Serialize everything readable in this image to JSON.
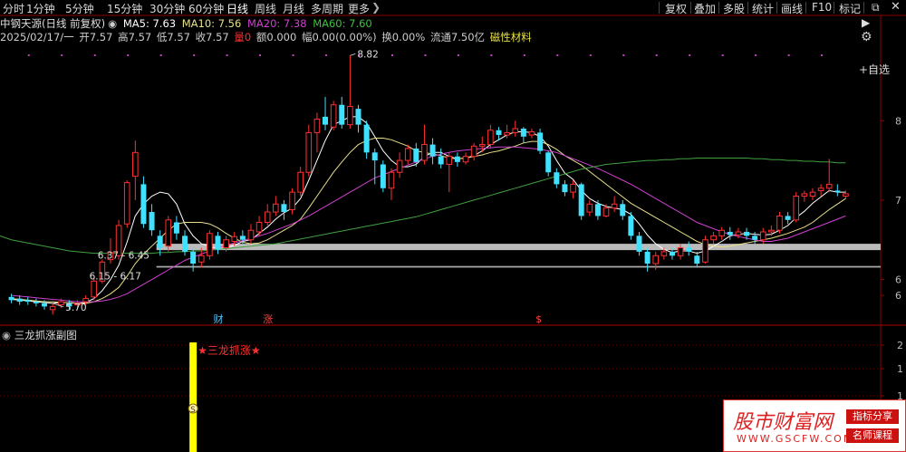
{
  "period_tabs": [
    "分时",
    "1分钟",
    "5分钟",
    "15分钟",
    "30分钟",
    "60分钟",
    "日线",
    "周线",
    "月线",
    "多周期",
    "更多"
  ],
  "active_tab": "日线",
  "toolbar": [
    "复权",
    "叠加",
    "多股",
    "统计",
    "画线",
    "F10",
    "标记"
  ],
  "legend": {
    "title": "中钢天源(日线 前复权)",
    "ma5_label": "MA5: 7.63",
    "ma10_label": "MA10: 7.56",
    "ma20_label": "MA20: 7.38",
    "ma60_label": "MA60: 7.60"
  },
  "ohlc": {
    "date": "2025/02/17/一",
    "open": "开7.57",
    "high": "高7.57",
    "low": "低7.57",
    "close": "收7.57",
    "volume": "量0",
    "amount": "额0.000",
    "amplitude": "幅0.00(0.00%)",
    "turnover": "换0.00%",
    "float_cap": "流通7.50亿",
    "concept": "磁性材料"
  },
  "side_buttons": {
    "add": "+自选"
  },
  "chart_data": {
    "type": "candlestick",
    "ylim": [
      5.55,
      8.95
    ],
    "y_ticks": [
      {
        "label": "8",
        "value": 8.0
      },
      {
        "label": "7",
        "value": 7.0
      },
      {
        "label": "6",
        "value": 6.0
      },
      {
        "label": "6",
        "value": 5.8
      }
    ],
    "candles": [
      [
        5.78,
        5.74,
        5.82,
        5.7
      ],
      [
        5.76,
        5.72,
        5.8,
        5.68
      ],
      [
        5.74,
        5.72,
        5.78,
        5.68
      ],
      [
        5.72,
        5.7,
        5.76,
        5.66
      ],
      [
        5.7,
        5.66,
        5.74,
        5.62
      ],
      [
        5.62,
        5.66,
        5.7,
        5.56
      ],
      [
        5.68,
        5.72,
        5.76,
        5.64
      ],
      [
        5.7,
        5.66,
        5.74,
        5.62
      ],
      [
        5.68,
        5.7,
        5.74,
        5.64
      ],
      [
        5.72,
        5.76,
        5.8,
        5.68
      ],
      [
        5.78,
        5.98,
        6.02,
        5.74
      ],
      [
        5.98,
        6.22,
        6.25,
        5.95
      ],
      [
        6.25,
        6.34,
        6.52,
        6.2
      ],
      [
        6.3,
        6.68,
        6.75,
        6.25
      ],
      [
        6.7,
        7.22,
        7.25,
        6.65
      ],
      [
        7.3,
        7.6,
        7.75,
        7.0
      ],
      [
        7.2,
        6.7,
        7.3,
        6.65
      ],
      [
        6.85,
        6.62,
        6.95,
        6.55
      ],
      [
        6.55,
        6.4,
        6.62,
        6.3
      ],
      [
        6.42,
        6.75,
        6.8,
        6.35
      ],
      [
        6.72,
        6.58,
        6.8,
        6.5
      ],
      [
        6.55,
        6.35,
        6.62,
        6.3
      ],
      [
        6.35,
        6.2,
        6.4,
        6.1
      ],
      [
        6.22,
        6.3,
        6.4,
        6.15
      ],
      [
        6.3,
        6.58,
        6.62,
        6.25
      ],
      [
        6.55,
        6.38,
        6.6,
        6.32
      ],
      [
        6.4,
        6.5,
        6.55,
        6.35
      ],
      [
        6.48,
        6.54,
        6.6,
        6.42
      ],
      [
        6.55,
        6.5,
        6.62,
        6.45
      ],
      [
        6.5,
        6.62,
        6.7,
        6.45
      ],
      [
        6.6,
        6.72,
        6.8,
        6.55
      ],
      [
        6.72,
        6.85,
        6.95,
        6.68
      ],
      [
        6.85,
        6.95,
        7.05,
        6.8
      ],
      [
        6.95,
        6.85,
        7.0,
        6.75
      ],
      [
        6.88,
        7.1,
        7.15,
        6.82
      ],
      [
        7.1,
        7.35,
        7.42,
        7.05
      ],
      [
        7.35,
        7.85,
        7.95,
        7.3
      ],
      [
        7.85,
        8.02,
        8.1,
        7.6
      ],
      [
        8.05,
        7.95,
        8.3,
        7.88
      ],
      [
        7.92,
        8.2,
        8.25,
        7.88
      ],
      [
        8.2,
        7.95,
        8.3,
        7.9
      ],
      [
        7.95,
        8.18,
        8.82,
        7.9
      ],
      [
        8.15,
        7.95,
        8.2,
        7.85
      ],
      [
        7.95,
        7.6,
        8.0,
        7.52
      ],
      [
        7.6,
        7.5,
        7.65,
        7.2
      ],
      [
        7.45,
        7.15,
        7.5,
        7.1
      ],
      [
        7.15,
        7.35,
        7.4,
        7.0
      ],
      [
        7.35,
        7.5,
        7.6,
        7.28
      ],
      [
        7.5,
        7.65,
        7.7,
        7.45
      ],
      [
        7.65,
        7.48,
        7.72,
        7.42
      ],
      [
        7.5,
        7.7,
        7.95,
        7.45
      ],
      [
        7.7,
        7.55,
        7.78,
        7.45
      ],
      [
        7.55,
        7.45,
        7.65,
        7.4
      ],
      [
        7.45,
        7.55,
        7.6,
        7.1
      ],
      [
        7.55,
        7.48,
        7.6,
        7.42
      ],
      [
        7.48,
        7.55,
        7.6,
        7.45
      ],
      [
        7.55,
        7.68,
        7.72,
        7.5
      ],
      [
        7.68,
        7.7,
        7.8,
        7.6
      ],
      [
        7.7,
        7.88,
        7.95,
        7.65
      ],
      [
        7.88,
        7.82,
        7.92,
        7.75
      ],
      [
        7.82,
        7.85,
        7.95,
        7.78
      ],
      [
        7.85,
        7.9,
        8.0,
        7.8
      ],
      [
        7.9,
        7.8,
        7.92,
        7.72
      ],
      [
        7.82,
        7.86,
        7.9,
        7.78
      ],
      [
        7.85,
        7.62,
        7.9,
        7.58
      ],
      [
        7.6,
        7.35,
        7.62,
        7.3
      ],
      [
        7.35,
        7.2,
        7.4,
        7.15
      ],
      [
        7.2,
        7.1,
        7.25,
        7.05
      ],
      [
        7.1,
        7.2,
        7.25,
        7.02
      ],
      [
        7.2,
        6.8,
        7.22,
        6.75
      ],
      [
        6.85,
        6.95,
        7.0,
        6.8
      ],
      [
        6.95,
        6.8,
        7.0,
        6.75
      ],
      [
        6.8,
        6.9,
        6.95,
        6.78
      ],
      [
        6.9,
        6.95,
        7.05,
        6.85
      ],
      [
        6.95,
        6.8,
        7.0,
        6.75
      ],
      [
        6.8,
        6.55,
        6.85,
        6.5
      ],
      [
        6.55,
        6.35,
        6.6,
        6.3
      ],
      [
        6.35,
        6.2,
        6.4,
        6.1
      ],
      [
        6.2,
        6.3,
        6.35,
        6.12
      ],
      [
        6.3,
        6.35,
        6.4,
        6.25
      ],
      [
        6.35,
        6.3,
        6.4,
        6.25
      ],
      [
        6.3,
        6.4,
        6.45,
        6.25
      ],
      [
        6.4,
        6.35,
        6.48,
        6.3
      ],
      [
        6.3,
        6.2,
        6.35,
        6.15
      ],
      [
        6.22,
        6.5,
        6.55,
        6.2
      ],
      [
        6.5,
        6.55,
        6.6,
        6.45
      ],
      [
        6.55,
        6.62,
        6.66,
        6.5
      ],
      [
        6.6,
        6.56,
        6.66,
        6.5
      ],
      [
        6.56,
        6.6,
        6.65,
        6.52
      ],
      [
        6.6,
        6.55,
        6.65,
        6.5
      ],
      [
        6.55,
        6.5,
        6.6,
        6.45
      ],
      [
        6.5,
        6.6,
        6.65,
        6.45
      ],
      [
        6.6,
        6.62,
        6.68,
        6.55
      ],
      [
        6.62,
        6.8,
        6.85,
        6.58
      ],
      [
        6.8,
        6.75,
        6.85,
        6.7
      ],
      [
        6.75,
        7.05,
        7.1,
        6.72
      ],
      [
        7.05,
        7.08,
        7.12,
        6.98
      ],
      [
        7.05,
        7.1,
        7.15,
        7.0
      ],
      [
        7.12,
        7.15,
        7.2,
        7.05
      ],
      [
        7.15,
        7.2,
        7.52,
        7.1
      ],
      [
        7.12,
        7.1,
        7.2,
        7.05
      ],
      [
        7.05,
        7.08,
        7.12,
        7.02
      ]
    ],
    "ma": [
      {
        "name": "MA5",
        "color": "#ffffff",
        "values": [
          5.75,
          5.74,
          5.73,
          5.72,
          5.71,
          5.7,
          5.71,
          5.71,
          5.7,
          5.71,
          5.76,
          5.86,
          6.0,
          6.18,
          6.47,
          6.8,
          6.95,
          7.05,
          7.1,
          7.08,
          6.95,
          6.7,
          6.55,
          6.45,
          6.42,
          6.38,
          6.4,
          6.43,
          6.48,
          6.5,
          6.58,
          6.66,
          6.76,
          6.84,
          6.9,
          7.02,
          7.25,
          7.5,
          7.75,
          7.95,
          8.0,
          8.05,
          8.05,
          7.97,
          7.8,
          7.62,
          7.5,
          7.42,
          7.42,
          7.45,
          7.55,
          7.6,
          7.6,
          7.55,
          7.52,
          7.53,
          7.56,
          7.62,
          7.7,
          7.76,
          7.82,
          7.86,
          7.86,
          7.85,
          7.8,
          7.68,
          7.5,
          7.34,
          7.26,
          7.12,
          7.02,
          6.96,
          6.92,
          6.9,
          6.88,
          6.82,
          6.7,
          6.56,
          6.45,
          6.38,
          6.34,
          6.36,
          6.36,
          6.33,
          6.36,
          6.42,
          6.48,
          6.55,
          6.57,
          6.58,
          6.57,
          6.56,
          6.57,
          6.62,
          6.68,
          6.78,
          6.86,
          6.96,
          7.04,
          7.12,
          7.1,
          7.1
        ]
      },
      {
        "name": "MA10",
        "color": "#e8e08a",
        "values": [
          5.76,
          5.75,
          5.74,
          5.73,
          5.72,
          5.72,
          5.71,
          5.71,
          5.7,
          5.7,
          5.72,
          5.76,
          5.82,
          5.9,
          6.04,
          6.2,
          6.32,
          6.42,
          6.52,
          6.62,
          6.7,
          6.72,
          6.72,
          6.72,
          6.7,
          6.65,
          6.58,
          6.52,
          6.47,
          6.45,
          6.46,
          6.5,
          6.56,
          6.62,
          6.68,
          6.76,
          6.9,
          7.05,
          7.2,
          7.35,
          7.48,
          7.6,
          7.7,
          7.75,
          7.78,
          7.78,
          7.76,
          7.72,
          7.68,
          7.62,
          7.6,
          7.58,
          7.56,
          7.53,
          7.52,
          7.53,
          7.55,
          7.57,
          7.6,
          7.62,
          7.65,
          7.68,
          7.72,
          7.74,
          7.74,
          7.7,
          7.64,
          7.56,
          7.5,
          7.44,
          7.36,
          7.28,
          7.2,
          7.12,
          7.04,
          6.96,
          6.9,
          6.84,
          6.78,
          6.72,
          6.66,
          6.6,
          6.54,
          6.48,
          6.44,
          6.42,
          6.41,
          6.42,
          6.44,
          6.46,
          6.48,
          6.5,
          6.52,
          6.55,
          6.58,
          6.62,
          6.66,
          6.72,
          6.8,
          6.88,
          6.95,
          7.02
        ]
      },
      {
        "name": "MA20",
        "color": "#d040d0",
        "values": [
          5.8,
          5.79,
          5.78,
          5.77,
          5.76,
          5.75,
          5.74,
          5.73,
          5.72,
          5.72,
          5.72,
          5.73,
          5.75,
          5.78,
          5.82,
          5.88,
          5.94,
          6.0,
          6.06,
          6.12,
          6.18,
          6.24,
          6.28,
          6.32,
          6.36,
          6.4,
          6.43,
          6.46,
          6.49,
          6.52,
          6.55,
          6.58,
          6.62,
          6.66,
          6.7,
          6.75,
          6.8,
          6.86,
          6.92,
          6.98,
          7.04,
          7.1,
          7.16,
          7.22,
          7.28,
          7.32,
          7.36,
          7.4,
          7.44,
          7.48,
          7.52,
          7.55,
          7.58,
          7.6,
          7.62,
          7.63,
          7.64,
          7.65,
          7.66,
          7.67,
          7.67,
          7.67,
          7.66,
          7.65,
          7.64,
          7.62,
          7.6,
          7.56,
          7.52,
          7.48,
          7.44,
          7.4,
          7.35,
          7.3,
          7.25,
          7.2,
          7.14,
          7.08,
          7.02,
          6.96,
          6.9,
          6.84,
          6.78,
          6.72,
          6.68,
          6.64,
          6.6,
          6.57,
          6.54,
          6.52,
          6.5,
          6.48,
          6.48,
          6.5,
          6.52,
          6.56,
          6.6,
          6.64,
          6.68,
          6.72,
          6.76,
          6.8
        ]
      },
      {
        "name": "MA60",
        "color": "#40a040",
        "values": [
          6.5,
          6.48,
          6.46,
          6.44,
          6.42,
          6.4,
          6.38,
          6.36,
          6.35,
          6.34,
          6.33,
          6.33,
          6.33,
          6.33,
          6.33,
          6.33,
          6.33,
          6.33,
          6.34,
          6.34,
          6.35,
          6.35,
          6.36,
          6.36,
          6.37,
          6.38,
          6.39,
          6.4,
          6.41,
          6.42,
          6.43,
          6.44,
          6.45,
          6.47,
          6.49,
          6.51,
          6.53,
          6.55,
          6.57,
          6.59,
          6.61,
          6.63,
          6.65,
          6.67,
          6.69,
          6.71,
          6.73,
          6.75,
          6.77,
          6.79,
          6.82,
          6.85,
          6.88,
          6.91,
          6.94,
          6.97,
          7.0,
          7.03,
          7.06,
          7.09,
          7.12,
          7.15,
          7.18,
          7.21,
          7.24,
          7.27,
          7.3,
          7.33,
          7.36,
          7.39,
          7.41,
          7.43,
          7.45,
          7.46,
          7.47,
          7.48,
          7.49,
          7.5,
          7.5,
          7.51,
          7.51,
          7.52,
          7.52,
          7.53,
          7.53,
          7.53,
          7.53,
          7.53,
          7.53,
          7.53,
          7.52,
          7.52,
          7.51,
          7.51,
          7.5,
          7.5,
          7.49,
          7.49,
          7.48,
          7.48,
          7.47,
          7.47
        ]
      }
    ],
    "annotations": [
      {
        "text": "8.82",
        "value": 8.82
      },
      {
        "text": "5.70",
        "value": 5.7
      },
      {
        "text": "6.37 - 6.45",
        "value": 6.42
      },
      {
        "text": "6.15 - 6.17",
        "value": 6.16
      }
    ],
    "zones": [
      {
        "from": 6.37,
        "to": 6.45,
        "color": "#bbbbbb"
      },
      {
        "from": 6.15,
        "to": 6.17,
        "color": "#aaaaaa"
      }
    ],
    "event_labels": [
      {
        "text": "财",
        "color": "#4fc3ff"
      },
      {
        "text": "涨",
        "color": "#ff4040"
      },
      {
        "text": "$",
        "color": "#ff4040"
      }
    ]
  },
  "indicator": {
    "title": "三龙抓涨副图",
    "signal_label": "★三龙抓涨★",
    "marker": "S",
    "y_ticks": [
      "2",
      "1",
      "1",
      "0"
    ]
  },
  "watermark": {
    "brand": "股市财富网",
    "url": "WWW.GSCFW.COM",
    "tag1": "指标分享",
    "tag2": "名师课程"
  },
  "colors": {
    "up": "#ff3030",
    "down": "#40e0ff",
    "grid": "#8b0000",
    "signal": "#ffff00"
  }
}
